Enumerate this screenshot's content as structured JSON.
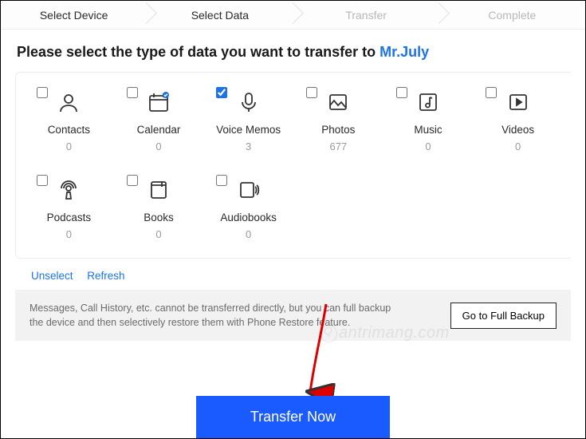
{
  "steps": [
    {
      "label": "Select Device",
      "state": "done"
    },
    {
      "label": "Select Data",
      "state": "active"
    },
    {
      "label": "Transfer",
      "state": "pending"
    },
    {
      "label": "Complete",
      "state": "pending"
    }
  ],
  "heading": {
    "prefix": "Please select the type of data you want to transfer to ",
    "target": "Mr.July"
  },
  "categories": [
    {
      "key": "contacts",
      "label": "Contacts",
      "count": "0",
      "checked": false
    },
    {
      "key": "calendar",
      "label": "Calendar",
      "count": "0",
      "checked": false
    },
    {
      "key": "voicememos",
      "label": "Voice Memos",
      "count": "3",
      "checked": true
    },
    {
      "key": "photos",
      "label": "Photos",
      "count": "677",
      "checked": false
    },
    {
      "key": "music",
      "label": "Music",
      "count": "0",
      "checked": false
    },
    {
      "key": "videos",
      "label": "Videos",
      "count": "0",
      "checked": false
    },
    {
      "key": "podcasts",
      "label": "Podcasts",
      "count": "0",
      "checked": false
    },
    {
      "key": "books",
      "label": "Books",
      "count": "0",
      "checked": false
    },
    {
      "key": "audiobooks",
      "label": "Audiobooks",
      "count": "0",
      "checked": false
    }
  ],
  "links": {
    "unselect": "Unselect",
    "refresh": "Refresh"
  },
  "infobar": {
    "message": "Messages, Call History, etc. cannot be transferred directly, but you can full backup the device and then selectively restore them with Phone Restore feature.",
    "button": "Go to Full Backup"
  },
  "action": {
    "transfer": "Transfer Now"
  },
  "watermark": "antrimang.com",
  "colors": {
    "accent": "#1a5bff",
    "link": "#1a73e8"
  }
}
